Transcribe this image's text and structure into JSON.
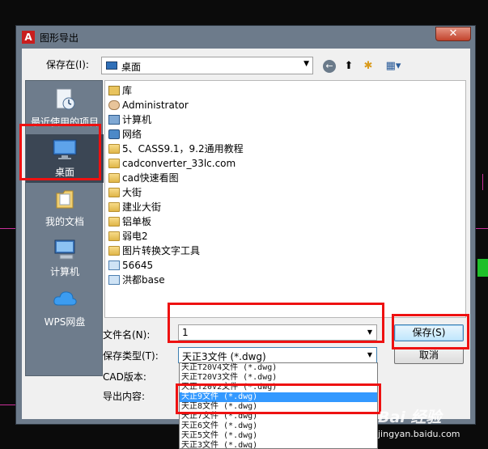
{
  "window": {
    "title": "图形导出",
    "app_icon_letter": "A",
    "close_glyph": "✕"
  },
  "look_in": {
    "label": "保存在(I):",
    "value": "桌面"
  },
  "toolbar": {
    "back_glyph": "←",
    "up_glyph": "⬆",
    "new_folder_glyph": "✱",
    "views_glyph": "▦▾"
  },
  "places": [
    {
      "label": "最近使用的项目",
      "icon": "recent-icon"
    },
    {
      "label": "桌面",
      "icon": "desktop-icon",
      "selected": true
    },
    {
      "label": "我的文档",
      "icon": "documents-icon"
    },
    {
      "label": "计算机",
      "icon": "computer-icon"
    },
    {
      "label": "WPS网盘",
      "icon": "cloud-icon"
    }
  ],
  "files": [
    {
      "name": "库",
      "icon": "lib"
    },
    {
      "name": "Administrator",
      "icon": "user"
    },
    {
      "name": "计算机",
      "icon": "pc"
    },
    {
      "name": "网络",
      "icon": "net"
    },
    {
      "name": "5、CASS9.1，9.2通用教程",
      "icon": "folder"
    },
    {
      "name": "cadconverter_33lc.com",
      "icon": "folder"
    },
    {
      "name": "cad快速看图",
      "icon": "folder"
    },
    {
      "name": "大街",
      "icon": "folder"
    },
    {
      "name": "建业大街",
      "icon": "folder"
    },
    {
      "name": "铝单板",
      "icon": "folder"
    },
    {
      "name": "弱电2",
      "icon": "folder"
    },
    {
      "name": "图片转换文字工具",
      "icon": "folder"
    },
    {
      "name": "56645",
      "icon": "img"
    },
    {
      "name": "洪都base",
      "icon": "img"
    }
  ],
  "form": {
    "filename_label": "文件名(N):",
    "filename_value": "1",
    "filetype_label": "保存类型(T):",
    "filetype_value": "天正3文件 (*.dwg)",
    "cad_version_label": "CAD版本:",
    "export_content_label": "导出内容:",
    "save_button": "保存(S)",
    "cancel_button": "取消",
    "combo_arrow": "▼"
  },
  "filetype_options": [
    {
      "label": "天正T20V4文件 (*.dwg)"
    },
    {
      "label": "天正T20V3文件 (*.dwg)"
    },
    {
      "label": "天正T20V2文件 (*.dwg)"
    },
    {
      "label": "天正9文件 (*.dwg)",
      "selected": true
    },
    {
      "label": "天正8文件 (*.dwg)"
    },
    {
      "label": "天正7文件 (*.dwg)"
    },
    {
      "label": "天正6文件 (*.dwg)"
    },
    {
      "label": "天正5文件 (*.dwg)"
    },
    {
      "label": "天正3文件 (*.dwg)"
    }
  ],
  "watermark": {
    "line1": "Bai 经验",
    "line2": "jingyan.baidu.com"
  },
  "colors": {
    "annotation": "#e11111",
    "selection": "#3399ff"
  }
}
